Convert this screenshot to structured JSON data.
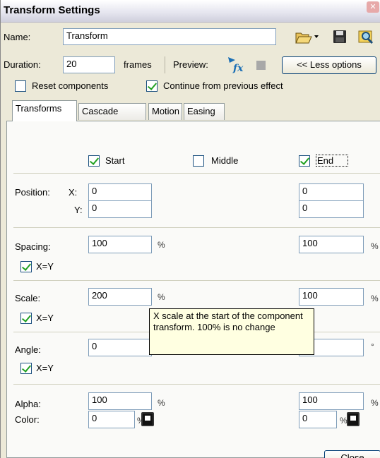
{
  "window": {
    "title": "Transform Settings"
  },
  "header": {
    "name_label": "Name:",
    "name_value": "Transform",
    "duration_label": "Duration:",
    "duration_value": "20",
    "frames_label": "frames",
    "preview_label": "Preview:",
    "less_options_label": "<< Less options",
    "reset_components_label": "Reset components",
    "continue_label": "Continue from previous effect"
  },
  "tabs": [
    {
      "label": "Transforms",
      "active": true
    },
    {
      "label": "Cascade",
      "active": false
    },
    {
      "label": "Motion",
      "active": false
    },
    {
      "label": "Easing",
      "active": false
    }
  ],
  "columns": {
    "start": {
      "label": "Start",
      "checked": true
    },
    "middle": {
      "label": "Middle",
      "checked": false
    },
    "end": {
      "label": "End",
      "checked": true
    }
  },
  "position": {
    "label": "Position:",
    "x_label": "X:",
    "y_label": "Y:",
    "start_x": "0",
    "start_y": "0",
    "end_x": "0",
    "end_y": "0"
  },
  "spacing": {
    "label": "Spacing:",
    "start": "100",
    "end": "100",
    "unit": "%",
    "xy_label": "X=Y",
    "xy_checked": true
  },
  "scale": {
    "label": "Scale:",
    "start": "200",
    "end": "100",
    "unit": "%",
    "xy_label": "X=Y",
    "xy_checked": true
  },
  "angle": {
    "label": "Angle:",
    "start": "0",
    "unit": "°",
    "xy_label": "X=Y",
    "xy_checked": true
  },
  "alpha": {
    "label": "Alpha:",
    "start": "100",
    "end": "100",
    "unit": "%"
  },
  "color": {
    "label": "Color:",
    "start": "0",
    "end": "0",
    "unit": "%"
  },
  "tooltip": {
    "text": "X scale at the start of the component transform. 100% is no change"
  },
  "footer": {
    "close_label": "Close"
  },
  "icons": [
    "close-window-icon",
    "open-folder-icon",
    "dropdown-arrow-icon",
    "save-disk-icon",
    "browse-icon",
    "preview-play-icon",
    "stop-icon",
    "color-picker-icon"
  ]
}
